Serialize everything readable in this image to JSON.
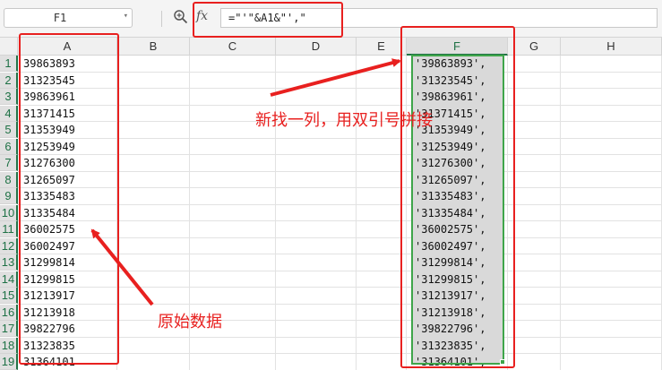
{
  "formula_bar": {
    "name_box": "F1",
    "name_box_arrow": "▾",
    "fx_label": "fx",
    "formula": "=\"'\"&A1&\"',\""
  },
  "columns": [
    "A",
    "B",
    "C",
    "D",
    "E",
    "F",
    "G",
    "H"
  ],
  "selected_column": "F",
  "rows": [
    "1",
    "2",
    "3",
    "4",
    "5",
    "6",
    "7",
    "8",
    "9",
    "10",
    "11",
    "12",
    "13",
    "14",
    "15",
    "16",
    "17",
    "18",
    "19"
  ],
  "column_a": [
    "39863893",
    "31323545",
    "39863961",
    "31371415",
    "31353949",
    "31253949",
    "31276300",
    "31265097",
    "31335483",
    "31335484",
    "36002575",
    "36002497",
    "31299814",
    "31299815",
    "31213917",
    "31213918",
    "39822796",
    "31323835",
    "31364101"
  ],
  "column_f": [
    "'39863893',",
    "'31323545',",
    "'39863961',",
    "'31371415',",
    "'31353949',",
    "'31253949',",
    "'31276300',",
    "'31265097',",
    "'31335483',",
    "'31335484',",
    "'36002575',",
    "'36002497',",
    "'31299814',",
    "'31299815',",
    "'31213917',",
    "'31213918',",
    "'39822796',",
    "'31323835',",
    "'31364101',"
  ],
  "annotations": {
    "new_column_note": "新找一列，用双引号拼接",
    "source_data_note": "原始数据"
  },
  "colors": {
    "annotation_red": "#e8201f",
    "selection_green": "#3fa54a",
    "header_bg": "#f0f0f0"
  }
}
